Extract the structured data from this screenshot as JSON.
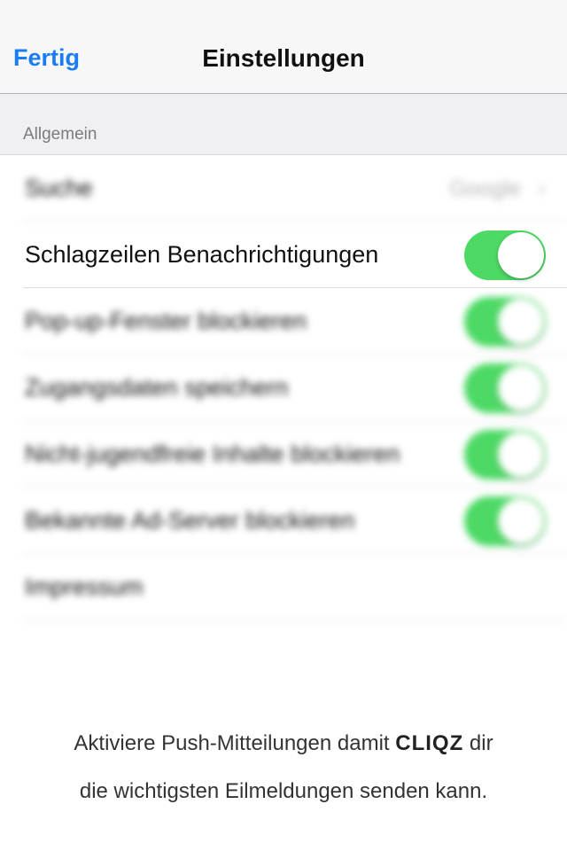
{
  "navbar": {
    "done_label": "Fertig",
    "title": "Einstellungen"
  },
  "section": {
    "header": "Allgemein"
  },
  "rows": [
    {
      "label": "Suche",
      "value": "Google",
      "type": "disclosure"
    },
    {
      "label": "Schlagzeilen Benachrichtigungen",
      "type": "toggle",
      "on": true
    },
    {
      "label": "Pop-up-Fenster blockieren",
      "type": "toggle",
      "on": true
    },
    {
      "label": "Zugangsdaten speichern",
      "type": "toggle",
      "on": true
    },
    {
      "label": "Nicht-jugendfreie Inhalte blockieren",
      "type": "toggle",
      "on": true
    },
    {
      "label": "Bekannte Ad-Server blockieren",
      "type": "toggle",
      "on": true
    },
    {
      "label": "Impressum",
      "type": "plain"
    }
  ],
  "footer": {
    "line1_prefix": "Aktiviere Push-Mitteilungen damit",
    "brand": "CLIQZ",
    "line1_suffix": "dir",
    "line2": "die wichtigsten Eilmeldungen senden kann."
  },
  "colors": {
    "accent": "#1a7cf5",
    "toggle_on": "#4cd964"
  }
}
